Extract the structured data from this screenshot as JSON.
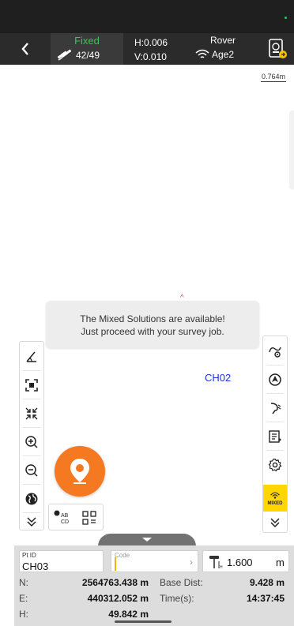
{
  "topbar": {
    "solution_status": "Fixed",
    "satellites": "42/49",
    "h_precision": "H:0.006",
    "v_precision": "V:0.010",
    "mode": "Rover",
    "age": "Age2"
  },
  "map": {
    "scale": "0.764m",
    "toast": {
      "line1": "The Mixed Solutions are available!",
      "line2": "Just proceed with your survey job."
    },
    "point_label": "CH02",
    "marker_glyph": "^"
  },
  "left_toolbar": [
    "angle-measure-icon",
    "zoom-extent-icon",
    "collapse-icon",
    "zoom-in-icon",
    "zoom-out-icon",
    "globe-icon",
    "expand-down-icon"
  ],
  "right_toolbar": [
    "stakeout-icon",
    "navigation-icon",
    "tilt-survey-icon",
    "point-list-icon",
    "settings-icon",
    "mixed-solution-icon",
    "expand-down-icon"
  ],
  "mixed_badge": "MIXED",
  "mini_toolbar": {
    "label_sub": "AB",
    "label_sub2": "CD"
  },
  "bottom_panel": {
    "pt_id_caption": "Pt ID",
    "pt_id": "CH03",
    "code_caption": "Code",
    "code_value": "",
    "antenna_height": "1.600",
    "antenna_unit": "m",
    "n_label": "N:",
    "n_value": "2564763.438 m",
    "e_label": "E:",
    "e_value": "440312.052 m",
    "h_label": "H:",
    "h_value": "49.842 m",
    "base_dist_label": "Base Dist:",
    "base_dist_value": "9.428 m",
    "time_label": "Time(s):",
    "time_value": "14:37:45"
  },
  "colors": {
    "fixed_green": "#34c759",
    "fab_orange": "#f47920",
    "mixed_yellow": "#ffd600",
    "point_blue": "#1a35d6"
  }
}
